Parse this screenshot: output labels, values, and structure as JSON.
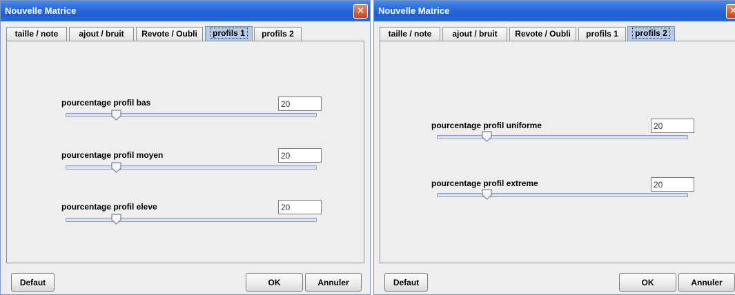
{
  "windows": [
    {
      "title": "Nouvelle Matrice",
      "tabs": [
        "taille / note",
        "ajout / bruit",
        "Revote / Oubli",
        "profils 1",
        "profils 2"
      ],
      "active_tab": "profils 1",
      "sliders": [
        {
          "label": "pourcentage profil bas",
          "value": "20",
          "level": 20
        },
        {
          "label": "pourcentage profil moyen",
          "value": "20",
          "level": 20
        },
        {
          "label": "pourcentage profil eleve",
          "value": "20",
          "level": 20
        }
      ],
      "buttons": {
        "default": "Defaut",
        "ok": "OK",
        "cancel": "Annuler"
      }
    },
    {
      "title": "Nouvelle Matrice",
      "tabs": [
        "taille / note",
        "ajout / bruit",
        "Revote / Oubli",
        "profils 1",
        "profils 2"
      ],
      "active_tab": "profils 2",
      "sliders": [
        {
          "label": "pourcentage profil uniforme",
          "value": "20",
          "level": 20
        },
        {
          "label": "pourcentage profil extreme",
          "value": "20",
          "level": 20
        }
      ],
      "buttons": {
        "default": "Defaut",
        "ok": "OK",
        "cancel": "Annuler"
      }
    }
  ],
  "colors": {
    "titlebar": "#2c6fde",
    "active_tab": "#b7cbe9",
    "panel": "#eeeeee"
  },
  "icons": {
    "close": "close-icon",
    "slider_thumb": "slider-thumb"
  }
}
